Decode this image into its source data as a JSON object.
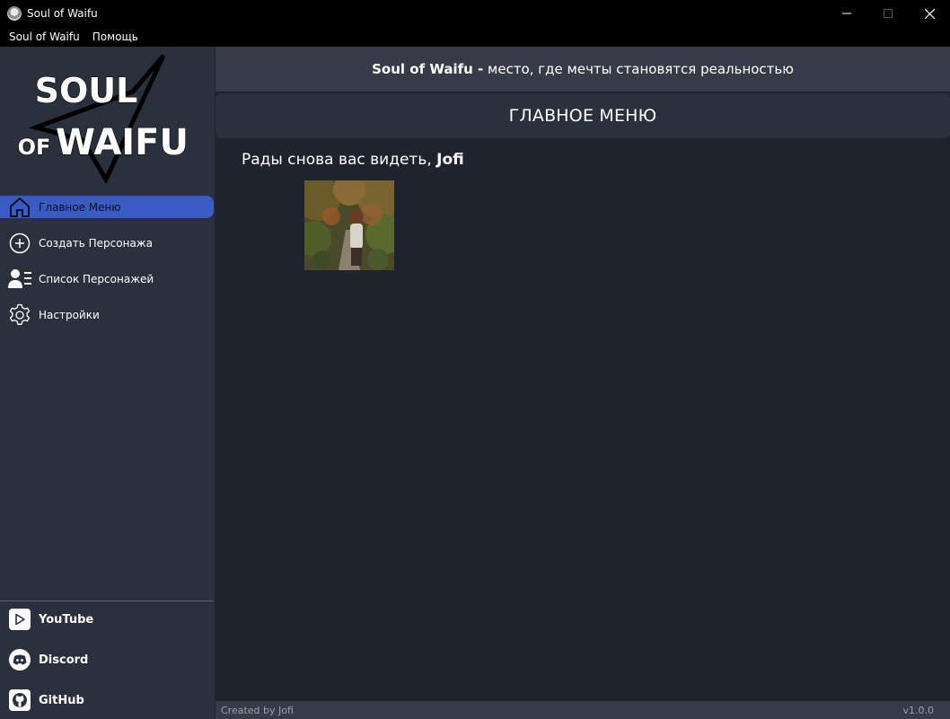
{
  "window": {
    "title": "Soul of Waifu",
    "app_icon": "app-logo-icon",
    "controls": [
      "minimize-icon",
      "maximize-icon",
      "close-icon"
    ]
  },
  "menubar": {
    "items": [
      "Soul of Waifu",
      "Помощь"
    ]
  },
  "sidebar": {
    "logo": {
      "line1": "SOUL",
      "line2_small": "OF",
      "line2_big": "WAIFU"
    },
    "nav": [
      {
        "label": "Главное Меню",
        "icon": "home-icon",
        "active": true
      },
      {
        "label": "Создать Персонажа",
        "icon": "add-circle-icon",
        "active": false
      },
      {
        "label": "Список Персонажей",
        "icon": "user-list-icon",
        "active": false
      },
      {
        "label": "Настройки",
        "icon": "gear-icon",
        "active": false
      }
    ],
    "links": [
      {
        "label": "YouTube",
        "icon": "youtube-icon"
      },
      {
        "label": "Discord",
        "icon": "discord-icon"
      },
      {
        "label": "GitHub",
        "icon": "github-icon"
      }
    ]
  },
  "topbar": {
    "brand": "Soul of Waifu -",
    "tagline": "место, где мечты становятся реальностью"
  },
  "header": {
    "title": "ГЛАВНОЕ МЕНЮ"
  },
  "content": {
    "greeting": "Рады снова вас видеть,",
    "username": "Jofi"
  },
  "status": {
    "created": "Created by Jofi",
    "version": "v1.0.0"
  },
  "colors": {
    "accent": "#3b5bc4",
    "sidebar_bg": "#2a303c",
    "content_bg": "#1e232d",
    "topbar_bg": "#363b47"
  }
}
